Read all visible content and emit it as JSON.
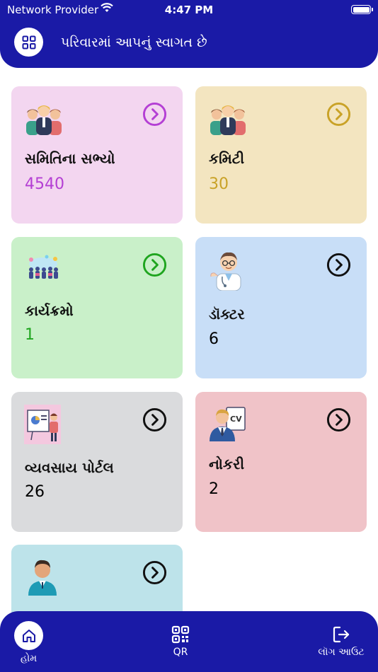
{
  "status": {
    "carrier": "Network Provider",
    "time": "4:47 PM"
  },
  "header": {
    "title": "પરિવારમાં આપનું સ્વાગત છે"
  },
  "cards": [
    {
      "label": "સમિતિના સભ્યો",
      "count": "4540",
      "icon": "people-group-icon",
      "bg": "#f3d6f0",
      "accent": "#b43fd4"
    },
    {
      "label": "કમિટી",
      "count": "30",
      "icon": "people-group-icon",
      "bg": "#f3e5c0",
      "accent": "#c9a227"
    },
    {
      "label": "કાર્યક્રમો",
      "count": "1",
      "icon": "event-crowd-icon",
      "bg": "#c9f0c9",
      "accent": "#1fa51f"
    },
    {
      "label": "ડૉક્ટર",
      "count": "6",
      "icon": "doctor-icon",
      "bg": "#c8def7",
      "accent": "#111111"
    },
    {
      "label": "વ્યવસાય પોર્ટલ",
      "count": "26",
      "icon": "presentation-board-icon",
      "bg": "#dadbdd",
      "accent": "#111111"
    },
    {
      "label": "નોકરી",
      "count": "2",
      "icon": "cv-resume-icon",
      "bg": "#f0c3c8",
      "accent": "#111111"
    },
    {
      "label": "",
      "count": "",
      "icon": "person-avatar-icon",
      "bg": "#bde3ea",
      "accent": "#111111"
    }
  ],
  "nav": {
    "home": "હોમ",
    "qr": "QR",
    "logout": "લૉગ આઉટ"
  },
  "colors": {
    "primary": "#1a1aa6"
  }
}
